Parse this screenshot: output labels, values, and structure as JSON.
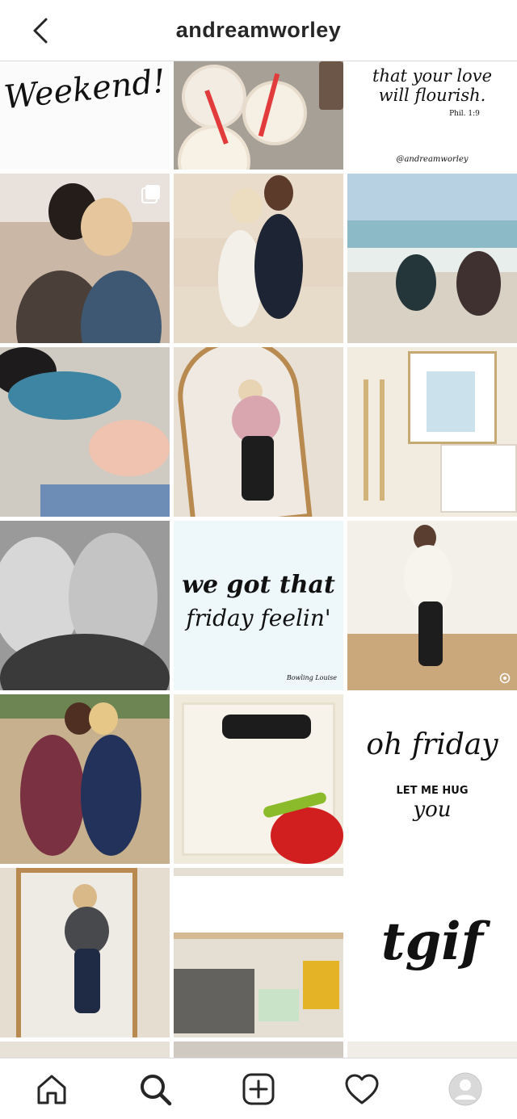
{
  "header": {
    "title": "andreamworley",
    "back_icon": "chevron-left-icon"
  },
  "posts": [
    {
      "id": "p1",
      "text": "Weekend!"
    },
    {
      "id": "p2",
      "description_icon": "drinks-photo"
    },
    {
      "id": "p3",
      "text": "that your love will flourish.",
      "ref": "Phil. 1:9",
      "handle": "@andreamworley"
    },
    {
      "id": "p4",
      "multi": true
    },
    {
      "id": "p5"
    },
    {
      "id": "p6"
    },
    {
      "id": "p7"
    },
    {
      "id": "p8"
    },
    {
      "id": "p9"
    },
    {
      "id": "p10"
    },
    {
      "id": "p11",
      "text_line1": "we got that",
      "text_line2": "friday feelin'",
      "signature": "Bowling Louise"
    },
    {
      "id": "p12"
    },
    {
      "id": "p13"
    },
    {
      "id": "p14"
    },
    {
      "id": "p15",
      "text_line1": "oh friday",
      "text_line2": "LET ME HUG",
      "text_line3": "you"
    },
    {
      "id": "p16"
    },
    {
      "id": "p17",
      "multi": true
    },
    {
      "id": "p18",
      "text": "tgif"
    }
  ],
  "tabbar": {
    "home_icon": "home-icon",
    "search_icon": "search-icon",
    "new_post_icon": "add-post-icon",
    "activity_icon": "heart-icon",
    "profile_icon": "profile-avatar"
  },
  "colors": {
    "text": "#262626",
    "divider": "#dbdbdb",
    "background": "#ffffff"
  }
}
